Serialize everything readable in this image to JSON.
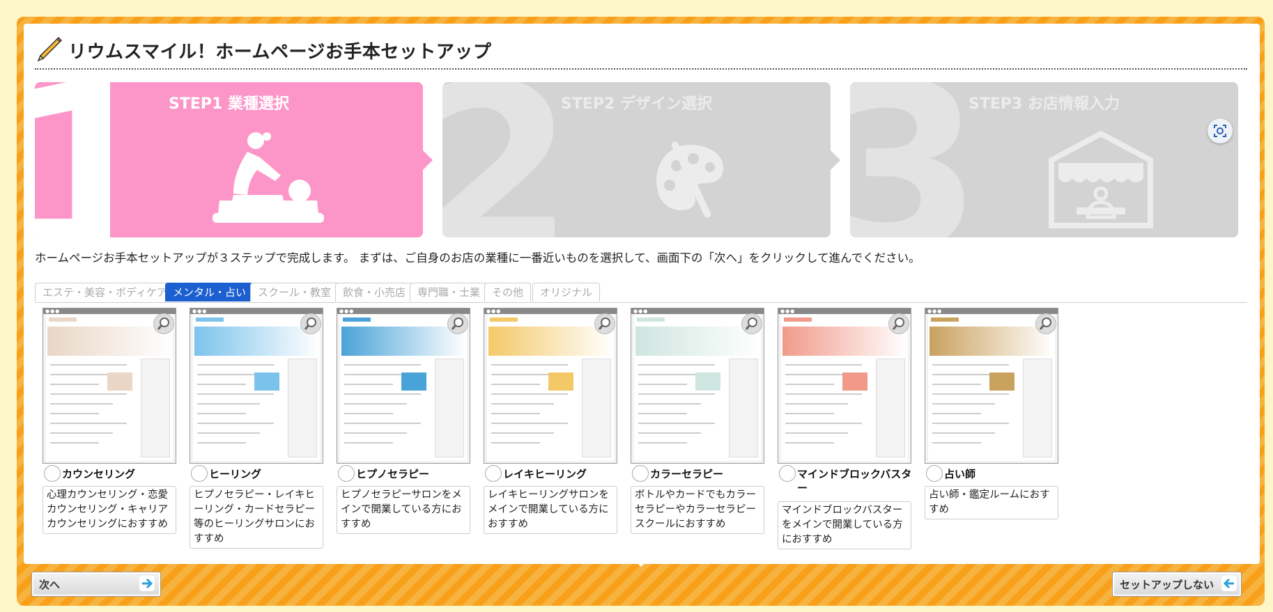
{
  "header": {
    "title": "リウムスマイル！ホームページお手本セットアップ",
    "icon": "pencil-icon"
  },
  "steps": [
    {
      "number": "1",
      "label": "STEP1 業種選択",
      "icon": "massage-icon",
      "active": true
    },
    {
      "number": "2",
      "label": "STEP2 デザイン選択",
      "icon": "palette-icon",
      "active": false
    },
    {
      "number": "3",
      "label": "STEP3 お店情報入力",
      "icon": "shop-icon",
      "active": false
    }
  ],
  "intro": "ホームページお手本セットアップが３ステップで完成します。 まずは、ご自身のお店の業種に一番近いものを選択して、画面下の「次へ」をクリックして進んでください。",
  "tabs": [
    {
      "label": "エステ・美容・ボディケア",
      "active": false
    },
    {
      "label": "メンタル・占い",
      "active": true
    },
    {
      "label": "スクール・教室",
      "active": false
    },
    {
      "label": "飲食・小売店",
      "active": false
    },
    {
      "label": "専門職・士業",
      "active": false
    },
    {
      "label": "その他",
      "active": false
    },
    {
      "label": "オリジナル",
      "active": false
    }
  ],
  "cards": [
    {
      "name": "カウンセリング",
      "desc": "心理カウンセリング・恋愛カウンセリング・キャリアカウンセリングにおすすめ"
    },
    {
      "name": "ヒーリング",
      "desc": "ヒプノセラピー・レイキヒーリング・カードセラピー等のヒーリングサロンにおすすめ"
    },
    {
      "name": "ヒプノセラピー",
      "desc": "ヒプノセラピーサロンをメインで開業している方におすすめ"
    },
    {
      "name": "レイキヒーリング",
      "desc": "レイキヒーリングサロンをメインで開業している方におすすめ"
    },
    {
      "name": "カラーセラピー",
      "desc": "ボトルやカードでもカラーセラピーやカラーセラピースクールにおすすめ"
    },
    {
      "name": "マインドブロックバスター",
      "desc": "マインドブロックバスターをメインで開業している方におすすめ"
    },
    {
      "name": "占い師",
      "desc": "占い師・鑑定ルームにおすすめ"
    }
  ],
  "footer": {
    "next_label": "次へ",
    "skip_label": "セットアップしない"
  },
  "colors": {
    "active_step": "#fd96c8",
    "inactive_step": "#d3d3d3",
    "frame": "#f9a01a",
    "active_tab": "#1b5fd0"
  }
}
